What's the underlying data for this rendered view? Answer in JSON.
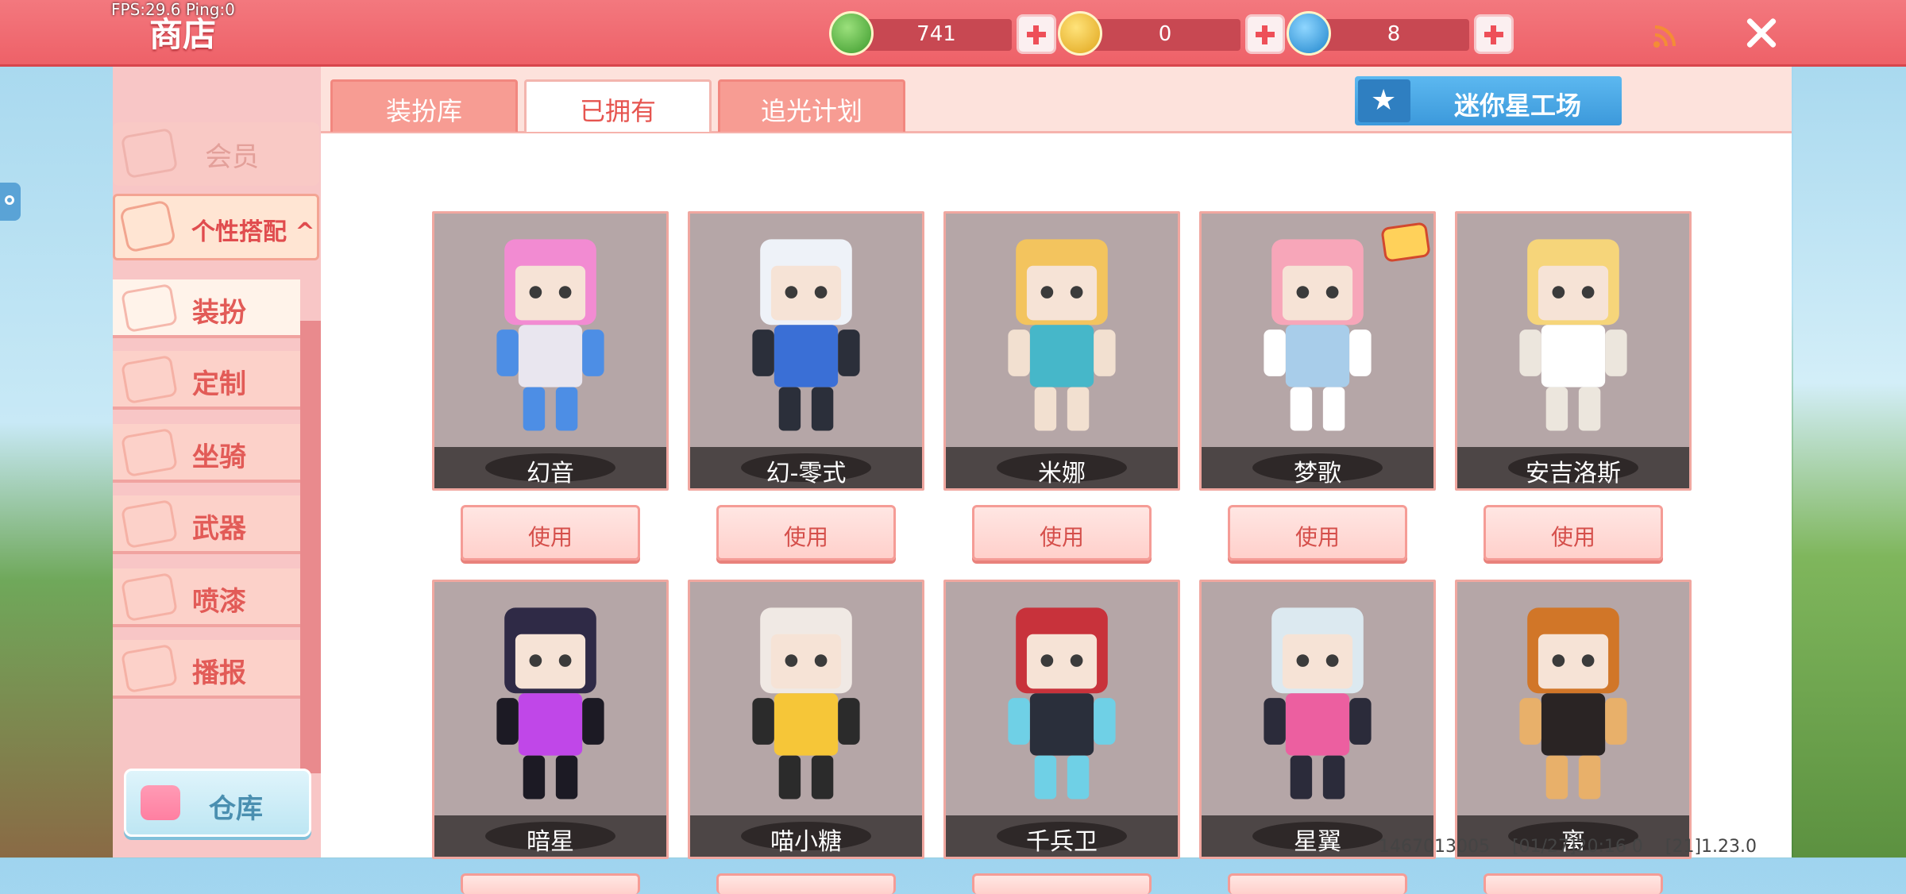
{
  "hud": {
    "fps": "FPS:29.6  Ping:0"
  },
  "header": {
    "title": "商店"
  },
  "currencies": [
    {
      "icon": "green-gem-icon",
      "color": "#4caf3a",
      "value": "741"
    },
    {
      "icon": "gold-m-coin-icon",
      "color": "#f2c12e",
      "value": "0"
    },
    {
      "icon": "blue-m-coin-icon",
      "color": "#2aa0e0",
      "value": "8"
    }
  ],
  "sidebar": {
    "member_label": "会员",
    "group_label": "个性搭配 ^",
    "items": [
      {
        "label": "装扮",
        "icon": "tshirt-icon",
        "active": true
      },
      {
        "label": "定制",
        "icon": "brush-icon"
      },
      {
        "label": "坐骑",
        "icon": "mount-icon"
      },
      {
        "label": "武器",
        "icon": "gun-icon"
      },
      {
        "label": "喷漆",
        "icon": "spray-can-icon"
      },
      {
        "label": "播报",
        "icon": "broadcast-icon"
      }
    ],
    "warehouse_label": "仓库"
  },
  "tabs": [
    {
      "label": "装扮库"
    },
    {
      "label": "已拥有",
      "active": true
    },
    {
      "label": "追光计划"
    }
  ],
  "mini_factory_label": "迷你星工场",
  "use_label": "使用",
  "skins": [
    {
      "name": "幻音",
      "palette": [
        "#f28bd2",
        "#e9e6ef",
        "#4d8ee5"
      ]
    },
    {
      "name": "幻-零式",
      "palette": [
        "#eef2f8",
        "#3a6fd6",
        "#2b2f3a"
      ]
    },
    {
      "name": "米娜",
      "palette": [
        "#f3c45e",
        "#46b7c9",
        "#f2e0d0"
      ]
    },
    {
      "name": "梦歌",
      "palette": [
        "#f7a6b9",
        "#a8cdea",
        "#ffffff"
      ],
      "badge": true
    },
    {
      "name": "安吉洛斯",
      "palette": [
        "#f6d57a",
        "#ffffff",
        "#ece6dd"
      ]
    },
    {
      "name": "暗星",
      "palette": [
        "#2f2a46",
        "#c047e8",
        "#1c1a24"
      ]
    },
    {
      "name": "喵小糖",
      "palette": [
        "#f0e9e4",
        "#f6c638",
        "#2b2b2b"
      ]
    },
    {
      "name": "千兵卫",
      "palette": [
        "#c8323b",
        "#2a2f3b",
        "#6fd0e6"
      ]
    },
    {
      "name": "星翼",
      "palette": [
        "#dce9f0",
        "#ec5fa0",
        "#2b2b3a"
      ]
    },
    {
      "name": "离",
      "palette": [
        "#d17628",
        "#2a2424",
        "#e8b06a"
      ]
    }
  ],
  "footer": {
    "ids": "1467013005    [01/27]20:16 0    [21]1.23.0"
  }
}
